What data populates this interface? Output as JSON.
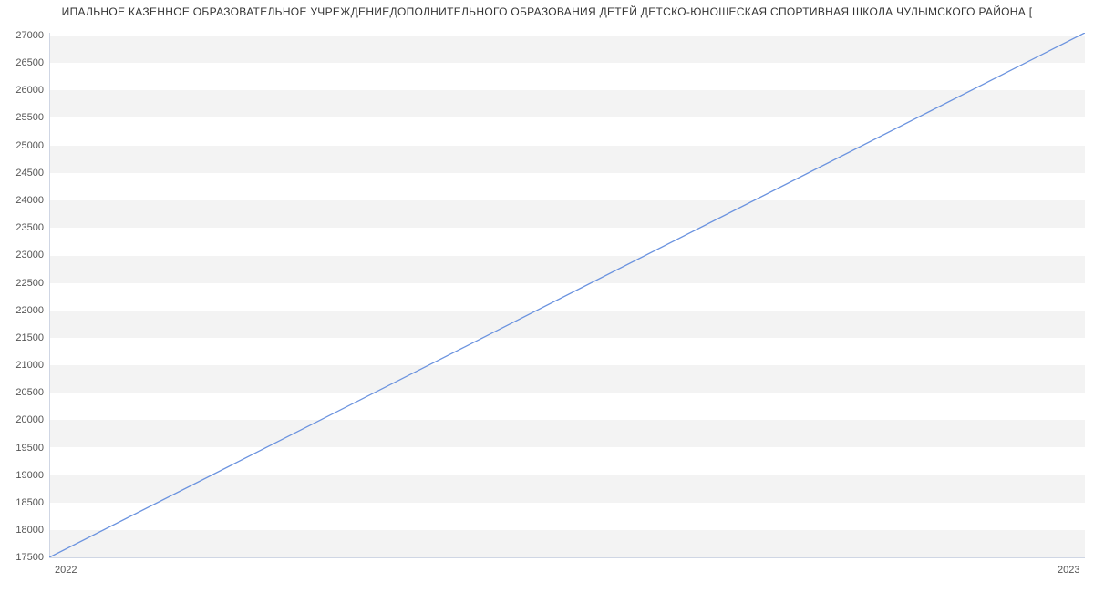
{
  "chart_data": {
    "type": "line",
    "title": "ИПАЛЬНОЕ КАЗЕННОЕ ОБРАЗОВАТЕЛЬНОЕ УЧРЕЖДЕНИЕДОПОЛНИТЕЛЬНОГО ОБРАЗОВАНИЯ ДЕТЕЙ ДЕТСКО-ЮНОШЕСКАЯ СПОРТИВНАЯ ШКОЛА ЧУЛЫМСКОГО РАЙОНА [",
    "x": [
      2022,
      2023
    ],
    "values": [
      17500,
      27050
    ],
    "xlabel": "",
    "ylabel": "",
    "xlim": [
      2022,
      2023
    ],
    "ylim": [
      17500,
      27050
    ],
    "y_ticks": [
      17500,
      18000,
      18500,
      19000,
      19500,
      20000,
      20500,
      21000,
      21500,
      22000,
      22500,
      23000,
      23500,
      24000,
      24500,
      25000,
      25500,
      26000,
      26500,
      27000
    ],
    "x_ticks": [
      2022,
      2023
    ],
    "grid": true
  }
}
